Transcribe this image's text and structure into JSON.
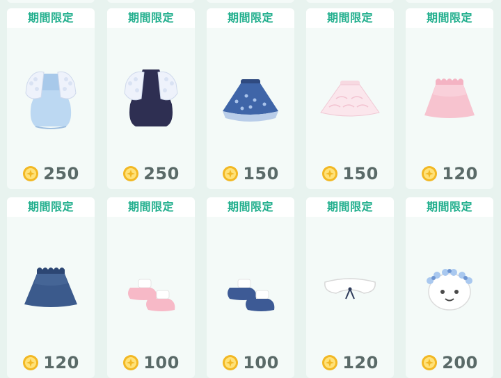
{
  "badge_label": "期間限定",
  "items": [
    {
      "name": "light-blue-lace-dress",
      "price": "250"
    },
    {
      "name": "navy-lace-dress",
      "price": "250"
    },
    {
      "name": "blue-floral-skirt",
      "price": "150"
    },
    {
      "name": "pink-lace-skirt",
      "price": "150"
    },
    {
      "name": "pink-ruffle-skirt",
      "price": "120"
    },
    {
      "name": "navy-skirt",
      "price": "120"
    },
    {
      "name": "pink-shoes",
      "price": "100"
    },
    {
      "name": "navy-shoes",
      "price": "100"
    },
    {
      "name": "white-collar-ribbon",
      "price": "120"
    },
    {
      "name": "blue-flower-crown",
      "price": "200"
    }
  ],
  "colors": {
    "badge": "#1fae8c",
    "price": "#5a6a68",
    "coin": "#f2b824"
  }
}
